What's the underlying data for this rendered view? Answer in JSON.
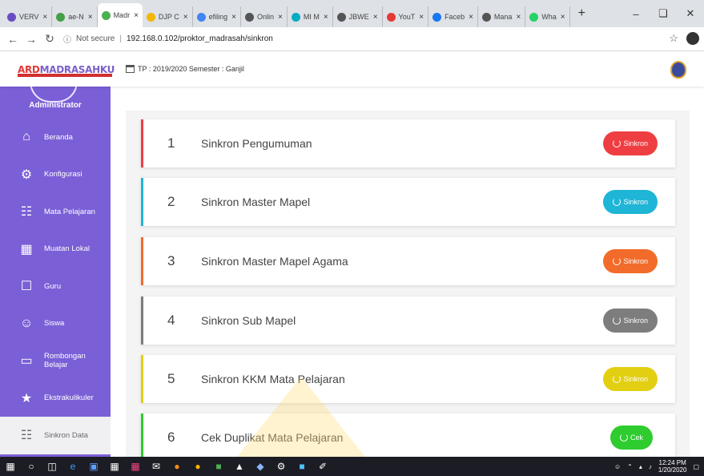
{
  "browser": {
    "tabs": [
      {
        "label": "VERV",
        "color": "#6a4bc4"
      },
      {
        "label": "ae-N",
        "color": "#43a047"
      },
      {
        "label": "Madr",
        "color": "#4caf50",
        "active": true
      },
      {
        "label": "DJP C",
        "color": "#f2b705"
      },
      {
        "label": "efiling",
        "color": "#4285f4",
        "glyph": "G"
      },
      {
        "label": "Onlin",
        "color": "#555555"
      },
      {
        "label": "MI M",
        "color": "#00acc1"
      },
      {
        "label": "JBWE",
        "color": "#555555"
      },
      {
        "label": "YouT",
        "color": "#e53935"
      },
      {
        "label": "Faceb",
        "color": "#1877f2"
      },
      {
        "label": "Mana",
        "color": "#555555"
      },
      {
        "label": "Wha",
        "color": "#25d366"
      }
    ],
    "new_tab": "+",
    "security": "Not secure",
    "url": "192.168.0.102/proktor_madrasah/sinkron"
  },
  "header": {
    "logo_a": "ARD",
    "logo_b": "MADRASAHKU",
    "tp_text": "TP : 2019/2020  Semester : Ganjil"
  },
  "sidebar": {
    "role": "Administrator",
    "items": [
      {
        "label": "Beranda",
        "icon": "home-icon"
      },
      {
        "label": "Konfigurasi",
        "icon": "gear-icon"
      },
      {
        "label": "Mata Pelajaran",
        "icon": "dots-grid-icon"
      },
      {
        "label": "Muatan Lokal",
        "icon": "grid-icon"
      },
      {
        "label": "Guru",
        "icon": "teacher-icon"
      },
      {
        "label": "Siswa",
        "icon": "student-icon"
      },
      {
        "label": "Rombongan",
        "label2": "Belajar",
        "icon": "classroom-icon"
      },
      {
        "label": "Ekstrakulikuler",
        "icon": "award-icon"
      },
      {
        "label": "Sinkron Data",
        "icon": "dots-grid-icon",
        "active": true
      }
    ]
  },
  "sync_items": [
    {
      "num": "1",
      "title": "Sinkron Pengumuman",
      "button": "Sinkron",
      "color": "#ef3e42"
    },
    {
      "num": "2",
      "title": "Sinkron Master Mapel",
      "button": "Sinkron",
      "color": "#1fb5d6"
    },
    {
      "num": "3",
      "title": "Sinkron Master Mapel Agama",
      "button": "Sinkron",
      "color": "#f26b2a"
    },
    {
      "num": "4",
      "title": "Sinkron Sub Mapel",
      "button": "Sinkron",
      "color": "#7d7d7d"
    },
    {
      "num": "5",
      "title": "Sinkron KKM Mata Pelajaran",
      "button": "Sinkron",
      "color": "#e2cf12"
    },
    {
      "num": "6",
      "title": "Cek Duplikat Mata Pelajaran",
      "button": "Cek",
      "color": "#2ecc2e"
    }
  ],
  "taskbar": {
    "clock_time": "12:24 PM",
    "clock_date": "1/20/2020"
  }
}
